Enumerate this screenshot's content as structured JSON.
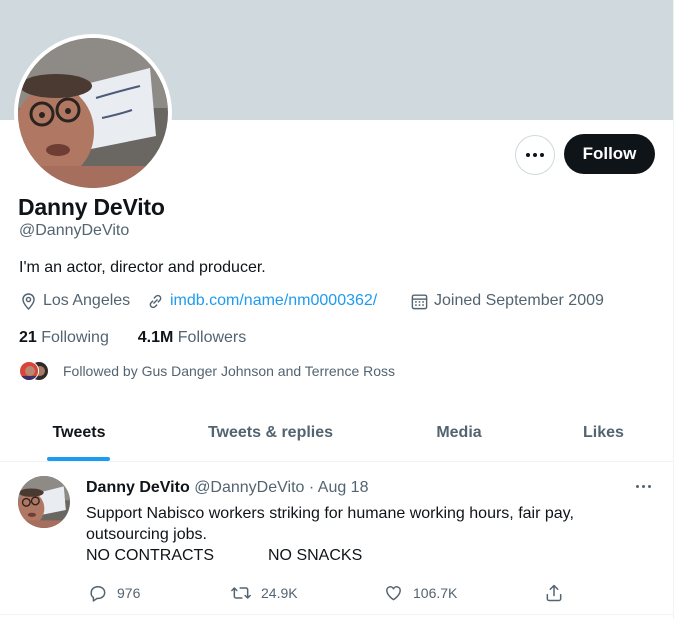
{
  "profile": {
    "name": "Danny DeVito",
    "handle": "@DannyDeVito",
    "bio": "I'm an actor, director and producer.",
    "location": "Los Angeles",
    "website": "imdb.com/name/nm0000362/",
    "joined": "Joined September 2009",
    "following_count": "21",
    "following_label": "Following",
    "followers_count": "4.1M",
    "followers_label": "Followers",
    "followed_by": "Followed by Gus Danger Johnson and Terrence Ross"
  },
  "actions": {
    "follow_label": "Follow"
  },
  "tabs": [
    {
      "label": "Tweets",
      "active": true
    },
    {
      "label": "Tweets & replies",
      "active": false
    },
    {
      "label": "Media",
      "active": false
    },
    {
      "label": "Likes",
      "active": false
    }
  ],
  "tweet": {
    "author_name": "Danny DeVito",
    "author_handle": "@DannyDeVito",
    "separator": "·",
    "date": "Aug 18",
    "text": "Support Nabisco workers striking for humane working hours, fair pay, outsourcing jobs.",
    "tail_left": "NO CONTRACTS",
    "tail_right": "NO SNACKS",
    "replies": "976",
    "retweets": "24.9K",
    "likes": "106.7K"
  },
  "icons": {
    "more": "more-dots-icon",
    "location": "map-pin-icon",
    "link": "link-icon",
    "calendar": "calendar-icon",
    "reply": "reply-icon",
    "retweet": "retweet-icon",
    "like": "heart-icon",
    "share": "share-icon"
  },
  "colors": {
    "banner": "#cfd9de",
    "accent": "#1d9bf0",
    "text_primary": "#0f1419",
    "text_secondary": "#536471",
    "follow_button": "#0f1419"
  }
}
